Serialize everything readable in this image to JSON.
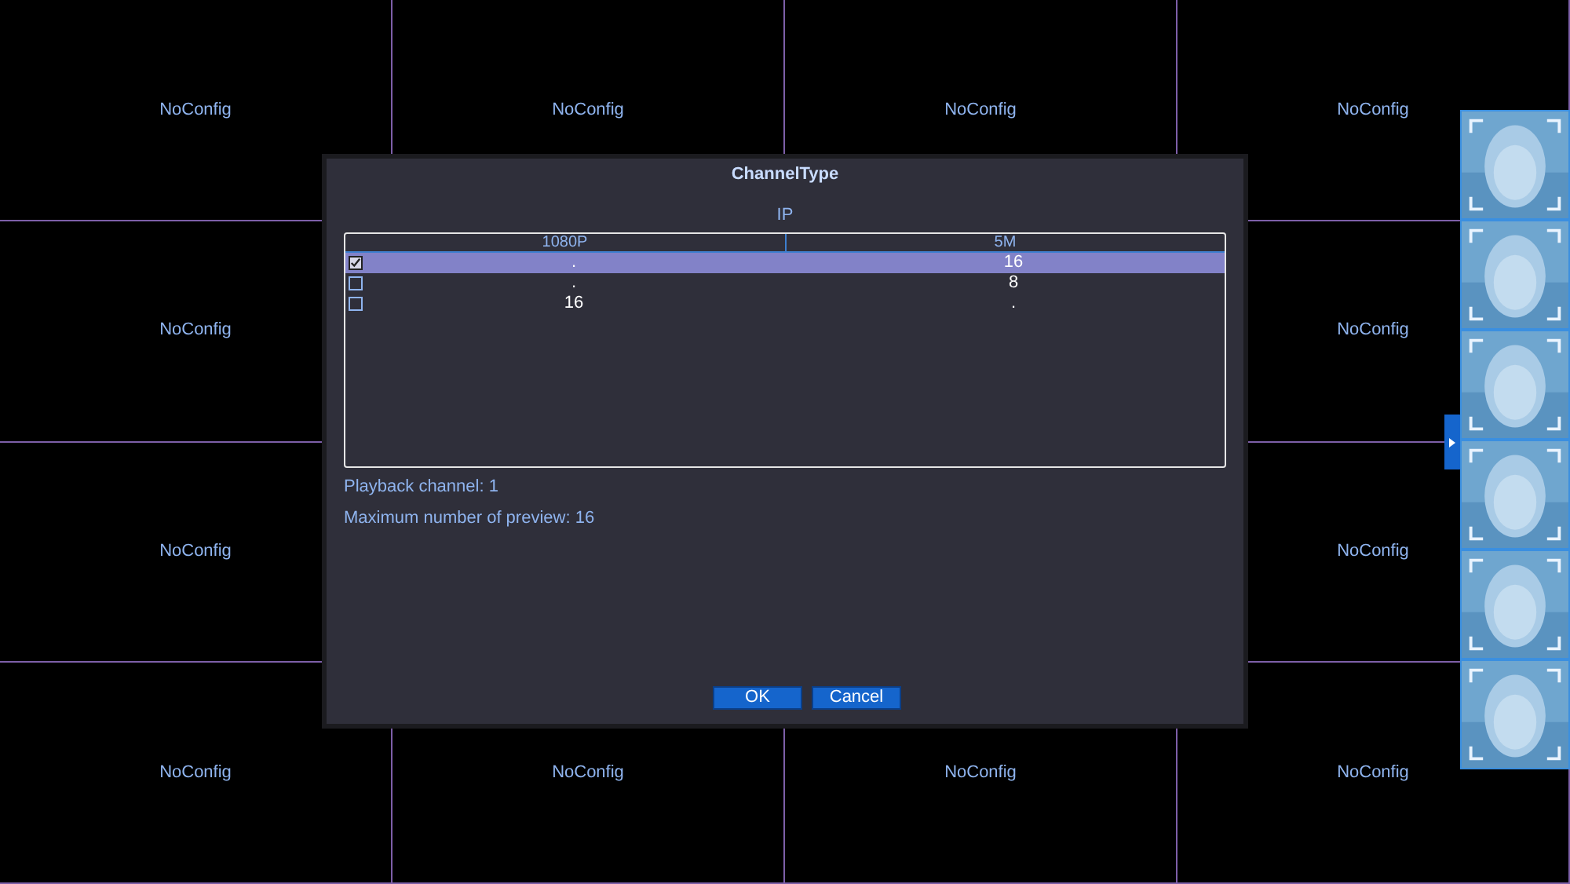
{
  "cells": [
    {
      "label": "NoConfig"
    },
    {
      "label": "NoConfig"
    },
    {
      "label": "NoConfig"
    },
    {
      "label": "NoConfig"
    },
    {
      "label": "NoConfig"
    },
    {},
    {},
    {
      "label": "NoConfig"
    },
    {
      "label": "NoConfig"
    },
    {},
    {},
    {
      "label": "NoConfig"
    },
    {
      "label": "NoConfig"
    },
    {
      "label": "NoConfig"
    },
    {
      "label": "NoConfig"
    },
    {
      "label": "NoConfig"
    }
  ],
  "dialog": {
    "title": "ChannelType",
    "group_label": "IP",
    "table": {
      "columns": [
        "1080P",
        "5M"
      ],
      "rows": [
        {
          "selected": true,
          "checked": true,
          "cells": [
            ".",
            "16"
          ]
        },
        {
          "selected": false,
          "checked": false,
          "cells": [
            ".",
            "8"
          ]
        },
        {
          "selected": false,
          "checked": false,
          "cells": [
            "16",
            "."
          ]
        }
      ]
    },
    "info": [
      "Playback channel: 1",
      "Maximum number of preview: 16"
    ],
    "buttons": [
      "OK",
      "Cancel"
    ]
  },
  "face_strip": {
    "expanded": false
  }
}
